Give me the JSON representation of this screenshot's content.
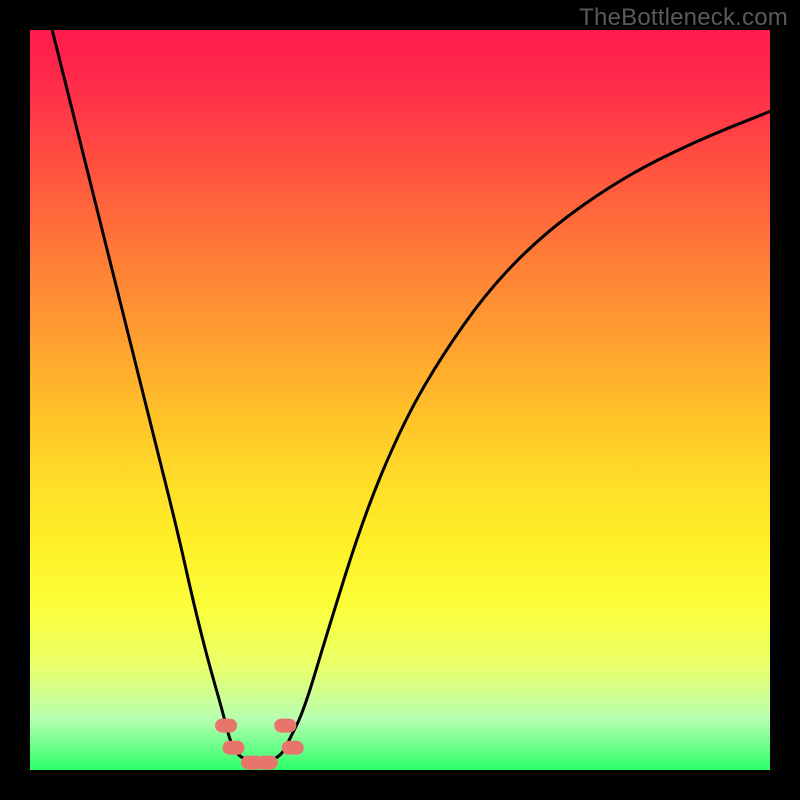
{
  "watermark": "TheBottleneck.com",
  "chart_data": {
    "type": "line",
    "title": "",
    "xlabel": "",
    "ylabel": "",
    "xlim": [
      0,
      100
    ],
    "ylim": [
      0,
      100
    ],
    "grid": false,
    "series": [
      {
        "name": "curve",
        "x": [
          3,
          6,
          10,
          14,
          17,
          20,
          22,
          24,
          26,
          27,
          28,
          30,
          32,
          34,
          35,
          37,
          40,
          45,
          50,
          55,
          62,
          70,
          80,
          90,
          100
        ],
        "y": [
          100,
          88,
          72,
          56,
          44,
          32,
          23,
          15,
          8,
          4,
          2,
          1,
          1,
          2,
          4,
          8,
          18,
          34,
          46,
          55,
          65,
          73,
          80,
          85,
          89
        ]
      }
    ],
    "markers": [
      {
        "x": 26.5,
        "y": 6
      },
      {
        "x": 27.5,
        "y": 3
      },
      {
        "x": 34.5,
        "y": 6
      },
      {
        "x": 35.5,
        "y": 3
      },
      {
        "x": 30.0,
        "y": 1
      },
      {
        "x": 32.0,
        "y": 1
      }
    ],
    "background_gradient": {
      "top": "#ff1a4d",
      "mid": "#ffe028",
      "bottom": "#2cff6a"
    }
  }
}
